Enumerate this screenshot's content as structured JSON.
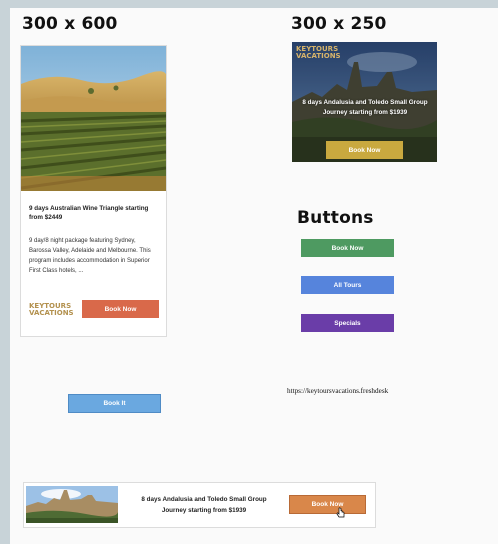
{
  "sections": {
    "size_300x600": "300 x 600",
    "size_300x250": "300 x 250",
    "buttons": "Buttons"
  },
  "ad_300x600": {
    "title": "9 days Australian Wine Triangle starting from $2449",
    "description": "9 day/8 night package featuring Sydney, Barossa Valley, Adelaide and Melbourne. This program includes accommodation in Superior First Class hotels, ...",
    "logo_line1": "KEYTOURS",
    "logo_line2": "VACATIONS",
    "button": "Book Now",
    "image_icon": "vineyard-photo"
  },
  "ad_300x250": {
    "logo_line1": "KEYTOURS",
    "logo_line2": "VACATIONS",
    "text": "8 days Andalusia and Toledo Small Group Journey starting from $1939",
    "button": "Book Now",
    "image_icon": "toledo-city-photo"
  },
  "buttons": {
    "book_now": "Book Now",
    "all_tours": "All Tours",
    "specials": "Specials",
    "book_it": "Book It"
  },
  "url_text": "https://keytoursvacations.freshdesk",
  "leaderboard": {
    "text": "8 days Andalusia and Toledo Small Group Journey starting from $1939",
    "button": "Book Now",
    "image_icon": "toledo-city-photo"
  },
  "colors": {
    "orange": "#d9694a",
    "gold": "#c9a93f",
    "green": "#4e9a61",
    "blue": "#5684dc",
    "purple": "#6a3da8",
    "light_blue": "#6aa8e0"
  }
}
